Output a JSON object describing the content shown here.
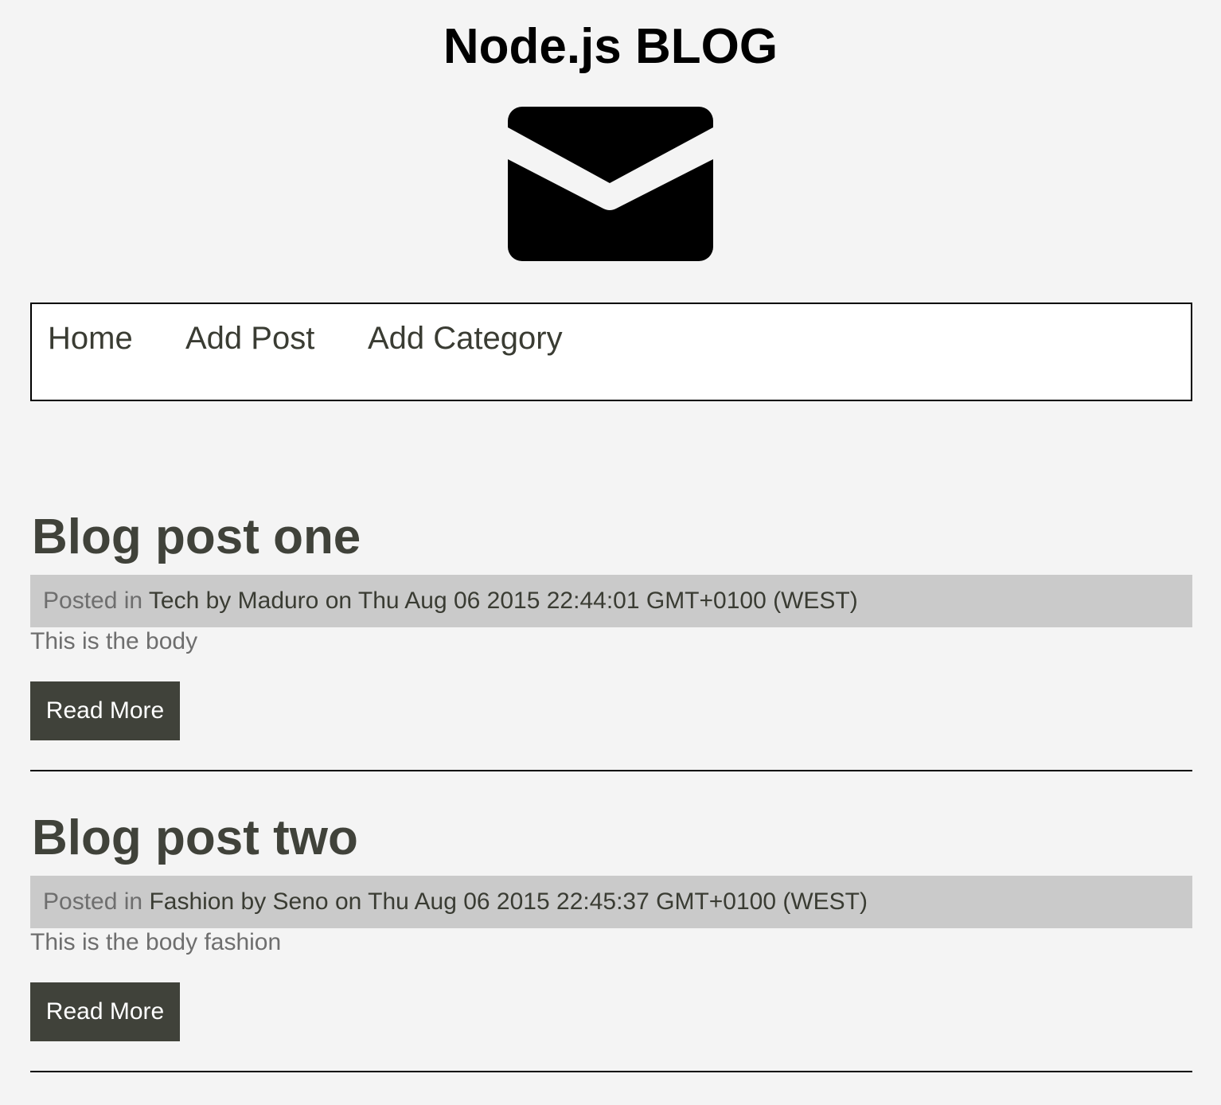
{
  "site": {
    "title": "Node.js BLOG",
    "logo_icon": "envelope-icon"
  },
  "nav": {
    "items": [
      {
        "label": "Home"
      },
      {
        "label": "Add Post"
      },
      {
        "label": "Add Category"
      }
    ]
  },
  "posts": [
    {
      "title": "Blog post one",
      "posted_in_label": "Posted in",
      "category": "Tech",
      "by_label": "by",
      "author": "Maduro",
      "on_label": "on",
      "date": "Thu Aug 06 2015 22:44:01 GMT+0100 (WEST)",
      "body": "This is the body",
      "read_more": "Read More"
    },
    {
      "title": "Blog post two",
      "posted_in_label": "Posted in",
      "category": "Fashion",
      "by_label": "by",
      "author": "Seno",
      "on_label": "on",
      "date": "Thu Aug 06 2015 22:45:37 GMT+0100 (WEST)",
      "body": "This is the body fashion",
      "read_more": "Read More"
    }
  ],
  "colors": {
    "background": "#f4f4f4",
    "nav_background": "#ffffff",
    "meta_background": "#cacaca",
    "button_background": "#40423a",
    "heading_text": "#40423a",
    "muted_text": "#6e6e6e"
  }
}
